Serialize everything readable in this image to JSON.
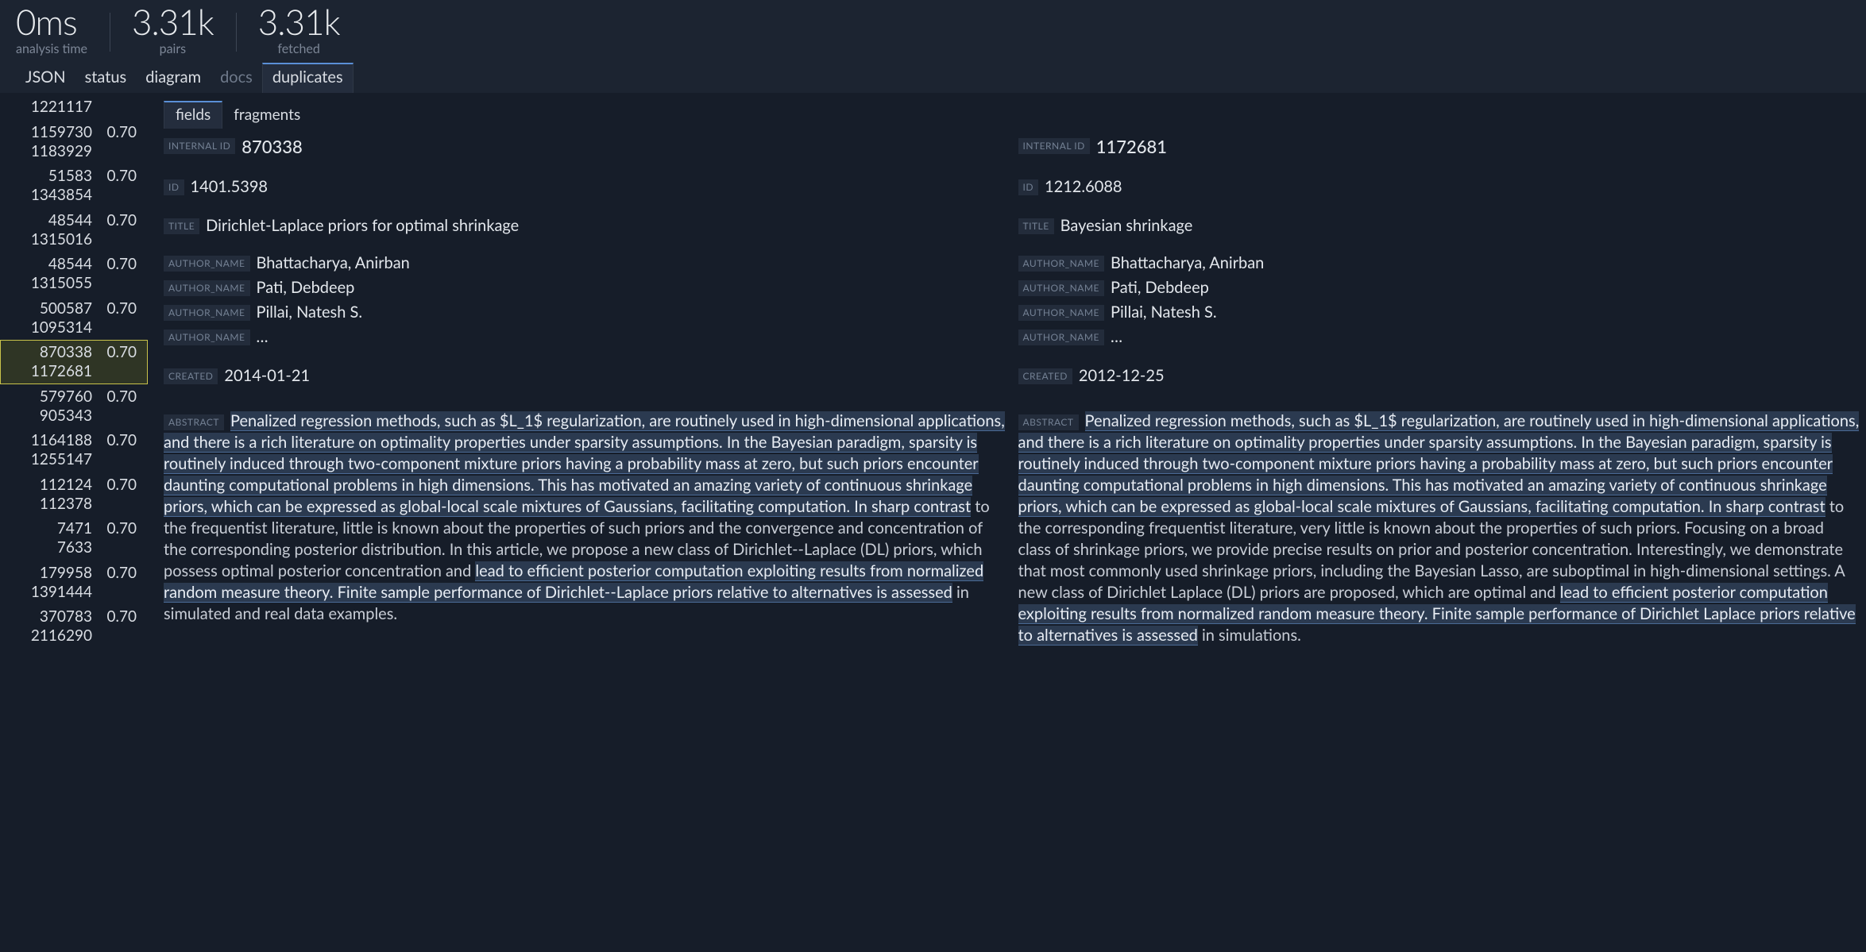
{
  "metrics": [
    {
      "value": "0ms",
      "label": "analysis time"
    },
    {
      "value": "3.31k",
      "label": "pairs"
    },
    {
      "value": "3.31k",
      "label": "fetched"
    }
  ],
  "primary_tabs": [
    {
      "label": "JSON",
      "state": ""
    },
    {
      "label": "status",
      "state": ""
    },
    {
      "label": "diagram",
      "state": ""
    },
    {
      "label": "docs",
      "state": "dim"
    },
    {
      "label": "duplicates",
      "state": "active"
    }
  ],
  "secondary_tabs": [
    {
      "label": "fields",
      "state": "active"
    },
    {
      "label": "fragments",
      "state": ""
    }
  ],
  "pairs": [
    {
      "id1": "1221117",
      "id2": null,
      "score": null,
      "selected": false
    },
    {
      "id1": "1159730",
      "id2": "1183929",
      "score": "0.70",
      "selected": false
    },
    {
      "id1": "51583",
      "id2": "1343854",
      "score": "0.70",
      "selected": false
    },
    {
      "id1": "48544",
      "id2": "1315016",
      "score": "0.70",
      "selected": false
    },
    {
      "id1": "48544",
      "id2": "1315055",
      "score": "0.70",
      "selected": false
    },
    {
      "id1": "500587",
      "id2": "1095314",
      "score": "0.70",
      "selected": false
    },
    {
      "id1": "870338",
      "id2": "1172681",
      "score": "0.70",
      "selected": true
    },
    {
      "id1": "579760",
      "id2": "905343",
      "score": "0.70",
      "selected": false
    },
    {
      "id1": "1164188",
      "id2": "1255147",
      "score": "0.70",
      "selected": false
    },
    {
      "id1": "112124",
      "id2": "112378",
      "score": "0.70",
      "selected": false
    },
    {
      "id1": "7471",
      "id2": "7633",
      "score": "0.70",
      "selected": false
    },
    {
      "id1": "179958",
      "id2": "1391444",
      "score": "0.70",
      "selected": false
    },
    {
      "id1": "370783",
      "id2": "2116290",
      "score": "0.70",
      "selected": false
    }
  ],
  "doc_left": {
    "internal_id": "870338",
    "id": "1401.5398",
    "title": "Dirichlet-Laplace priors for optimal shrinkage",
    "authors": [
      "Bhattacharya, Anirban",
      "Pati, Debdeep",
      "Pillai, Natesh S.",
      "…"
    ],
    "created": "2014-01-21",
    "abstract_segments": [
      {
        "t": "Penalized regression methods, such as $L_1$ regularization, are routinely used in high-dimensional applications, and there is a rich literature on optimality properties under sparsity assumptions. In the Bayesian paradigm, sparsity is routinely induced through two-component mixture priors having a probability mass at zero, but such priors encounter daunting computational problems in high dimensions. This has motivated an amazing variety of continuous shrinkage priors, which can be expressed as global-local scale mixtures of Gaussians, facilitating computation. In sharp contrast",
        "hl": true
      },
      {
        "t": " to the frequentist literature, little is known about the properties of such priors and the convergence and concentration of the corresponding posterior distribution. In this article, we propose a new class of Dirichlet--Laplace (DL) priors, which possess optimal posterior concentration and ",
        "hl": false
      },
      {
        "t": "lead to efficient posterior computation exploiting results from normalized random measure theory. Finite sample performance of Dirichlet--Laplace priors relative to alternatives is assessed",
        "hl": true
      },
      {
        "t": " in simulated and real data examples.",
        "hl": false
      }
    ]
  },
  "doc_right": {
    "internal_id": "1172681",
    "id": "1212.6088",
    "title": "Bayesian shrinkage",
    "authors": [
      "Bhattacharya, Anirban",
      "Pati, Debdeep",
      "Pillai, Natesh S.",
      "…"
    ],
    "created": "2012-12-25",
    "abstract_segments": [
      {
        "t": "Penalized regression methods, such as $L_1$ regularization, are routinely used in high-dimensional applications, and there is a rich literature on optimality properties under sparsity assumptions. In the Bayesian paradigm, sparsity is routinely induced through two-component mixture priors having a probability mass at zero, but such priors encounter daunting computational problems in high dimensions. This has motivated an amazing variety of continuous shrinkage priors, which can be expressed as global-local scale mixtures of Gaussians, facilitating computation. In sharp contrast",
        "hl": true
      },
      {
        "t": " to the corresponding frequentist literature, very little is known about the properties of such priors. Focusing on a broad class of shrinkage priors, we provide precise results on prior and posterior concentration. Interestingly, we demonstrate that most commonly used shrinkage priors, including the Bayesian Lasso, are suboptimal in high-dimensional settings. A new class of Dirichlet Laplace (DL) priors are proposed, which are optimal and ",
        "hl": false
      },
      {
        "t": "lead to efficient posterior computation exploiting results from normalized random measure theory. Finite sample performance of Dirichlet Laplace priors relative to alternatives is assessed",
        "hl": true
      },
      {
        "t": " in simulations.",
        "hl": false
      }
    ]
  },
  "labels": {
    "internal_id": "INTERNAL ID",
    "id": "ID",
    "title": "TITLE",
    "author": "AUTHOR_NAME",
    "created": "CREATED",
    "abstract": "ABSTRACT"
  }
}
